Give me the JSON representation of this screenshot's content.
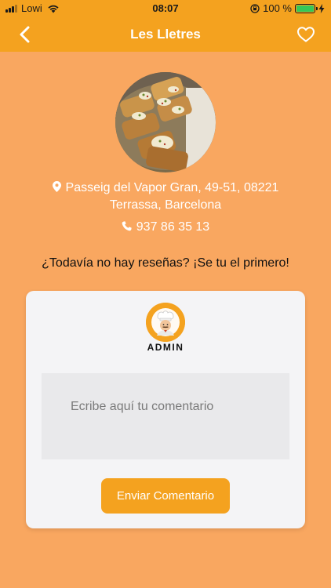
{
  "status_bar": {
    "carrier": "Lowi",
    "time": "08:07",
    "battery_percent": "100 %",
    "battery_color": "#35C759"
  },
  "nav": {
    "title": "Les Lletres",
    "back_icon": "chevron-left-icon",
    "favorite_icon": "heart-outline-icon"
  },
  "restaurant": {
    "photo_icon": "food-photo",
    "address_line1": "Passeig del Vapor Gran, 49-51, 08221",
    "address_line2": "Terrassa, Barcelona",
    "phone": "937 86 35 13"
  },
  "reviews": {
    "empty_message": "¿Todavía no hay reseñas? ¡Se tu el primero!"
  },
  "comment_card": {
    "user_label": "ADMIN",
    "avatar_icon": "chef-avatar-icon",
    "input_placeholder": "Ecribe aquí tu comentario",
    "input_value": "",
    "submit_label": "Enviar Comentario"
  },
  "colors": {
    "accent": "#F4A21F",
    "background": "#F9A760",
    "card": "#F4F4F6"
  }
}
